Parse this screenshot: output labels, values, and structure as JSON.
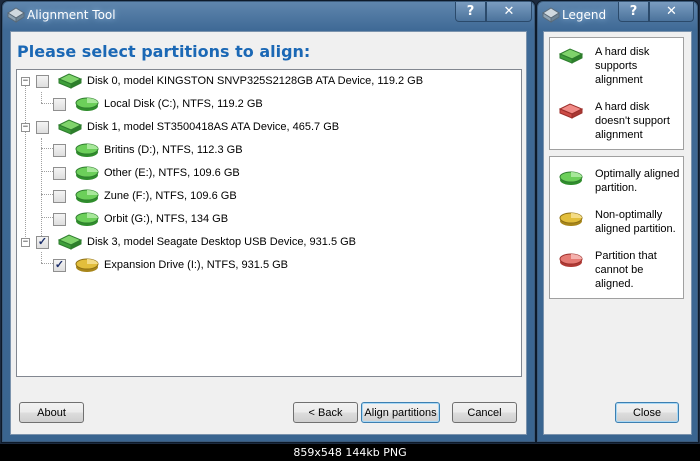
{
  "main_window": {
    "title": "Alignment Tool",
    "help_label": "?",
    "close_label": "✕",
    "heading": "Please select partitions to align:",
    "tree": [
      {
        "type": "disk",
        "label": "Disk 0, model KINGSTON SNVP325S2128GB ATA Device, 119.2 GB",
        "checked": false,
        "icon": "hard-disk-green-icon"
      },
      {
        "type": "partition",
        "label": "Local Disk (C:), NTFS, 119.2 GB",
        "checked": false,
        "icon": "partition-green-icon"
      },
      {
        "type": "disk",
        "label": "Disk 1, model ST3500418AS ATA Device, 465.7 GB",
        "checked": false,
        "icon": "hard-disk-green-icon"
      },
      {
        "type": "partition",
        "label": "Britins (D:), NTFS, 112.3 GB",
        "checked": false,
        "icon": "partition-green-icon"
      },
      {
        "type": "partition",
        "label": "Other (E:), NTFS, 109.6 GB",
        "checked": false,
        "icon": "partition-green-icon"
      },
      {
        "type": "partition",
        "label": "Zune (F:), NTFS, 109.6 GB",
        "checked": false,
        "icon": "partition-green-icon"
      },
      {
        "type": "partition",
        "label": "Orbit (G:), NTFS, 134 GB",
        "checked": false,
        "icon": "partition-green-icon"
      },
      {
        "type": "disk",
        "label": "Disk 3, model Seagate Desktop USB Device, 931.5 GB",
        "checked": true,
        "icon": "hard-disk-green-icon"
      },
      {
        "type": "partition",
        "label": "Expansion Drive (I:), NTFS, 931.5 GB",
        "checked": true,
        "icon": "partition-yellow-icon"
      }
    ],
    "buttons": {
      "about": "About",
      "back": "< Back",
      "align": "Align partitions",
      "cancel": "Cancel"
    }
  },
  "legend_window": {
    "title": "Legend",
    "help_label": "?",
    "close_label": "✕",
    "disk_items": [
      {
        "text": "A hard disk supports alignment",
        "icon": "hard-disk-green-icon"
      },
      {
        "text": "A hard disk doesn't support alignment",
        "icon": "hard-disk-red-icon"
      }
    ],
    "partition_items": [
      {
        "text": "Optimally aligned partition.",
        "icon": "partition-green-icon"
      },
      {
        "text": "Non-optimally aligned partition.",
        "icon": "partition-yellow-icon"
      },
      {
        "text": "Partition that cannot be aligned.",
        "icon": "partition-red-icon"
      }
    ],
    "close_button": "Close"
  },
  "status_bar": {
    "text": "859x548  144kb  PNG"
  },
  "colors": {
    "heading": "#1b68b5",
    "green": "#3cb043",
    "yellow": "#d9b52a",
    "red": "#d9534f"
  }
}
